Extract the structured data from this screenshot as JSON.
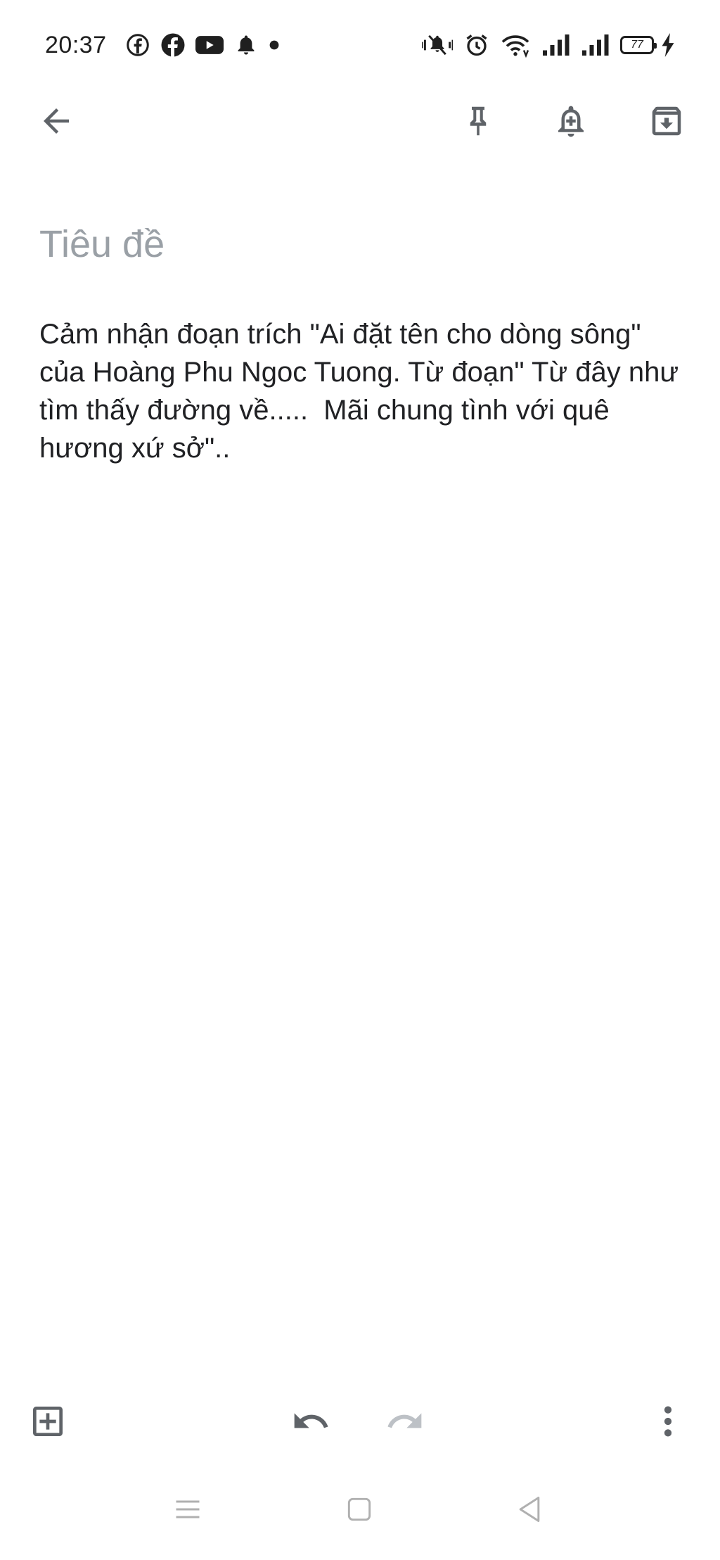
{
  "status_bar": {
    "time": "20:37",
    "left_icons": [
      "facebook-outline-icon",
      "facebook-icon",
      "youtube-icon",
      "bell-icon",
      "dot-icon"
    ],
    "right_icons": [
      "vibrate-mute-icon",
      "alarm-icon",
      "wifi-icon",
      "signal-icon",
      "signal-icon"
    ],
    "battery_level": "77",
    "charging": true
  },
  "toolbar": {
    "back": "back-arrow-icon",
    "pin": "pin-icon",
    "reminder": "reminder-bell-icon",
    "archive": "archive-icon"
  },
  "note": {
    "title_placeholder": "Tiêu đề",
    "body": "Cảm nhận đoạn trích \"Ai đặt tên cho dòng sông\" của Hoàng Phu Ngoc Tuong. Từ đoạn\" Từ đây như tìm thấy đường về.....  Mãi chung tình với quê hương xứ sở\".."
  },
  "bottom_toolbar": {
    "add": "add-box-icon",
    "undo": "undo-icon",
    "redo": "redo-icon",
    "more": "more-vert-icon"
  },
  "nav_bar": {
    "menu": "menu-icon",
    "home": "home-square-icon",
    "back": "back-triangle-icon"
  },
  "colors": {
    "icon": "#5f6368",
    "icon_disabled": "#bdc1c6",
    "placeholder": "#9aa0a6",
    "text": "#202124",
    "nav": "#b0b0b0"
  }
}
